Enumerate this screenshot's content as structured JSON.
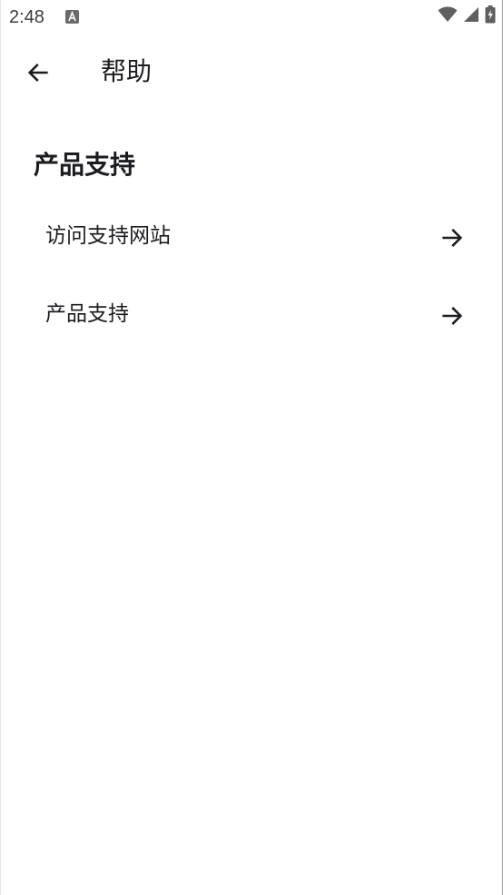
{
  "status_bar": {
    "time": "2:48",
    "icons": [
      "text-notification-icon",
      "wifi-icon",
      "cellular-signal-icon",
      "battery-charging-icon"
    ]
  },
  "app_bar": {
    "back_icon": "arrow-left-icon",
    "title": "帮助"
  },
  "section": {
    "title": "产品支持",
    "items": [
      {
        "label": "访问支持网站",
        "icon": "arrow-right-icon"
      },
      {
        "label": "产品支持",
        "icon": "arrow-right-icon"
      }
    ]
  },
  "colors": {
    "background": "#ffffff",
    "text": "#1c1b1f",
    "status_icons": "#5f5f5f"
  }
}
